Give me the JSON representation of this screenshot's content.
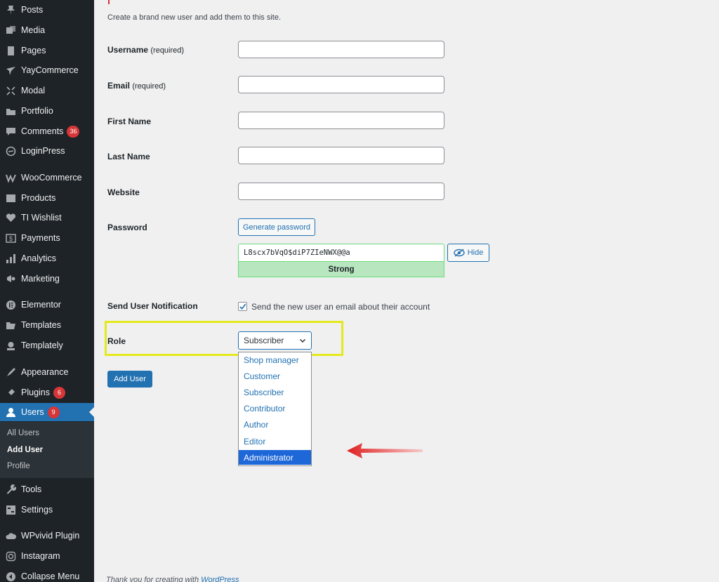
{
  "sidebar": {
    "items": [
      {
        "label": "Posts",
        "icon": "pin-icon"
      },
      {
        "label": "Media",
        "icon": "media-icon"
      },
      {
        "label": "Pages",
        "icon": "pages-icon"
      },
      {
        "label": "YayCommerce",
        "icon": "yaycommerce-icon"
      },
      {
        "label": "Modal",
        "icon": "modal-icon"
      },
      {
        "label": "Portfolio",
        "icon": "portfolio-icon"
      },
      {
        "label": "Comments",
        "icon": "comments-icon",
        "badge": "36"
      },
      {
        "label": "LoginPress",
        "icon": "loginpress-icon"
      },
      {
        "label": "WooCommerce",
        "icon": "woocommerce-icon"
      },
      {
        "label": "Products",
        "icon": "products-icon"
      },
      {
        "label": "TI Wishlist",
        "icon": "wishlist-icon"
      },
      {
        "label": "Payments",
        "icon": "payments-icon"
      },
      {
        "label": "Analytics",
        "icon": "analytics-icon"
      },
      {
        "label": "Marketing",
        "icon": "marketing-icon"
      },
      {
        "label": "Elementor",
        "icon": "elementor-icon"
      },
      {
        "label": "Templates",
        "icon": "templates-icon"
      },
      {
        "label": "Templately",
        "icon": "templately-icon"
      },
      {
        "label": "Appearance",
        "icon": "appearance-icon"
      },
      {
        "label": "Plugins",
        "icon": "plugins-icon",
        "badge": "6"
      },
      {
        "label": "Users",
        "icon": "users-icon",
        "badge": "9"
      },
      {
        "label": "Tools",
        "icon": "tools-icon"
      },
      {
        "label": "Settings",
        "icon": "settings-icon"
      },
      {
        "label": "WPvivid Plugin",
        "icon": "cloud-icon"
      },
      {
        "label": "Instagram",
        "icon": "instagram-icon"
      },
      {
        "label": "Collapse Menu",
        "icon": "collapse-icon"
      }
    ],
    "submenu": [
      "All Users",
      "Add User",
      "Profile"
    ]
  },
  "form": {
    "intro": "Create a brand new user and add them to this site.",
    "username_label": "Username",
    "email_label": "Email",
    "required": "(required)",
    "first_name_label": "First Name",
    "last_name_label": "Last Name",
    "website_label": "Website",
    "password_label": "Password",
    "generate_password": "Generate password",
    "password_value": "L8scx7bVqO$diP7ZIeNWX@@a",
    "hide": "Hide",
    "strength": "Strong",
    "notification_label": "Send User Notification",
    "notification_text": "Send the new user an email about their account",
    "role_label": "Role",
    "role_selected": "Subscriber",
    "role_options": [
      "Shop manager",
      "Customer",
      "Subscriber",
      "Contributor",
      "Author",
      "Editor",
      "Administrator"
    ],
    "add_user": "Add User"
  },
  "footer": {
    "text": "Thank you for creating with ",
    "link": "WordPress"
  },
  "colors": {
    "sidebar_bg": "#1d2327",
    "accent": "#2271b1",
    "highlight": "#e5e91b",
    "arrow": "#e02020"
  }
}
